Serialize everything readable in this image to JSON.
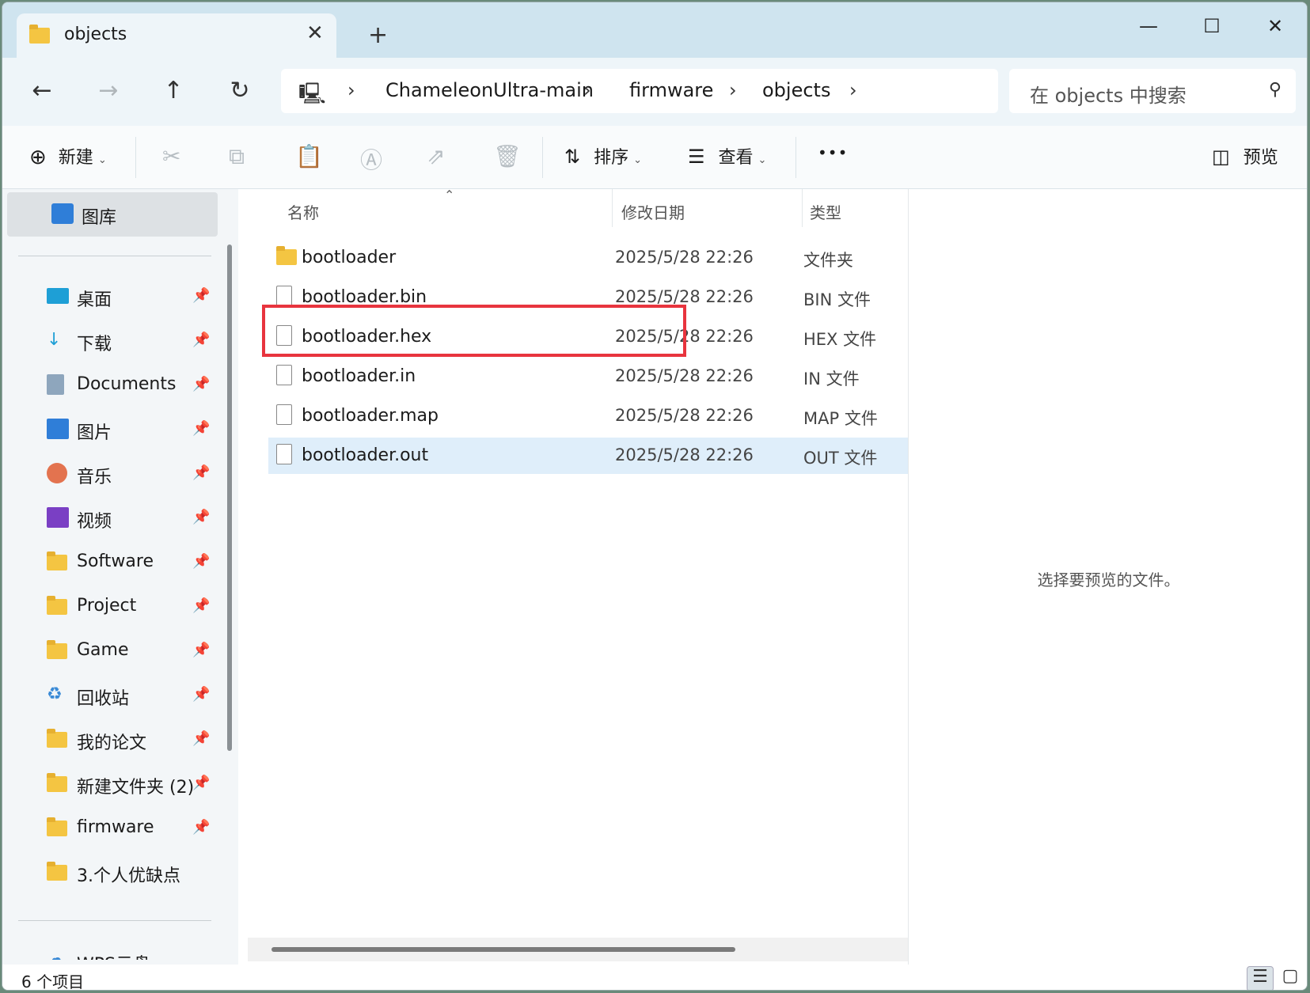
{
  "tab": {
    "title": "objects",
    "close": "✕",
    "new_tab": "+"
  },
  "window_controls": {
    "minimize": "—",
    "maximize": "☐",
    "close": "✕"
  },
  "nav": {
    "back": "←",
    "forward": "→",
    "up": "↑",
    "refresh": "↻",
    "address": [
      "ChameleonUltra-main",
      "firmware",
      "objects"
    ],
    "sep": "›",
    "search_placeholder": "在 objects 中搜索"
  },
  "toolbar": {
    "new": "新建",
    "sort": "排序",
    "view": "查看",
    "more": "•••",
    "preview": "预览"
  },
  "sidebar": {
    "top": "图库",
    "items": [
      {
        "label": "桌面",
        "icon": "desktop-icon"
      },
      {
        "label": "下载",
        "icon": "download-icon"
      },
      {
        "label": "Documents",
        "icon": "documents-icon"
      },
      {
        "label": "图片",
        "icon": "pictures-icon"
      },
      {
        "label": "音乐",
        "icon": "music-icon"
      },
      {
        "label": "视频",
        "icon": "video-icon"
      },
      {
        "label": "Software",
        "icon": "folder-icon"
      },
      {
        "label": "Project",
        "icon": "folder-icon"
      },
      {
        "label": "Game",
        "icon": "folder-icon"
      },
      {
        "label": "回收站",
        "icon": "recycle-bin-icon"
      },
      {
        "label": "我的论文",
        "icon": "folder-icon"
      },
      {
        "label": "新建文件夹 (2)",
        "icon": "folder-icon"
      },
      {
        "label": "firmware",
        "icon": "folder-icon"
      },
      {
        "label": "3.个人优缺点",
        "icon": "folder-icon"
      }
    ],
    "bottom_partial": "WPS云盘"
  },
  "columns": {
    "name": "名称",
    "date": "修改日期",
    "type": "类型"
  },
  "files": [
    {
      "name": "bootloader",
      "date": "2025/5/28 22:26",
      "type": "文件夹",
      "kind": "folder"
    },
    {
      "name": "bootloader.bin",
      "date": "2025/5/28 22:26",
      "type": "BIN 文件",
      "kind": "file"
    },
    {
      "name": "bootloader.hex",
      "date": "2025/5/28 22:26",
      "type": "HEX 文件",
      "kind": "file"
    },
    {
      "name": "bootloader.in",
      "date": "2025/5/28 22:26",
      "type": "IN 文件",
      "kind": "file"
    },
    {
      "name": "bootloader.map",
      "date": "2025/5/28 22:26",
      "type": "MAP 文件",
      "kind": "file"
    },
    {
      "name": "bootloader.out",
      "date": "2025/5/28 22:26",
      "type": "OUT 文件",
      "kind": "file"
    }
  ],
  "preview_pane": {
    "message": "选择要预览的文件。"
  },
  "status": {
    "count": "6 个项目"
  },
  "colors": {
    "accent": "#0067c0",
    "highlight_box": "#e8343e",
    "selected_row": "#dfeefa"
  }
}
